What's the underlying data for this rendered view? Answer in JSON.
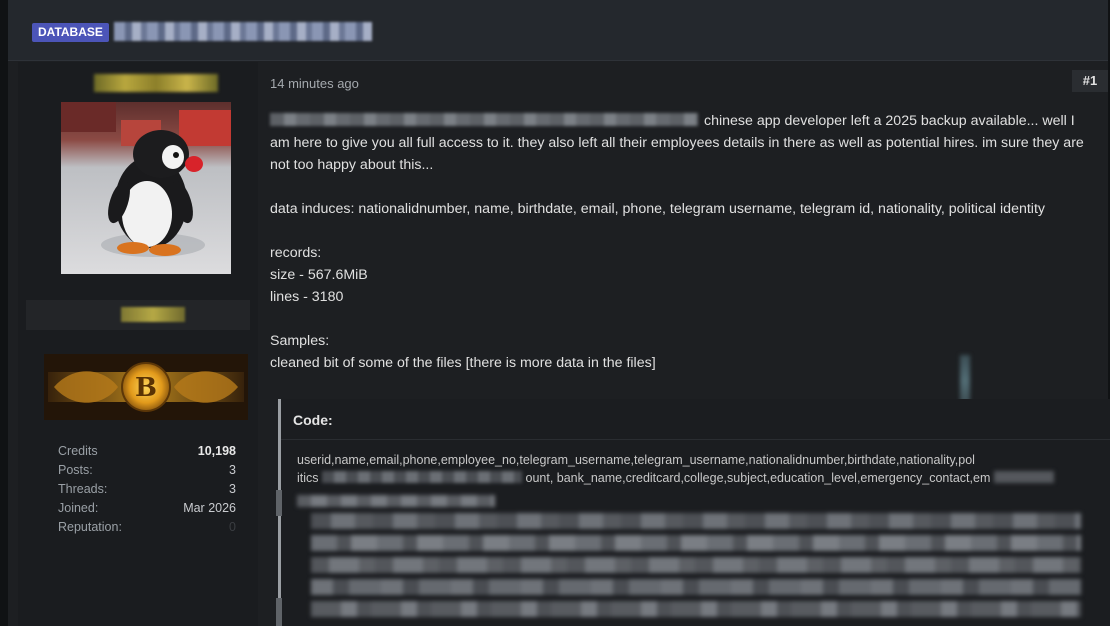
{
  "header": {
    "tag_label": "DATABASE"
  },
  "sidebar": {
    "stats": [
      {
        "label": "Credits",
        "value": "10,198"
      },
      {
        "label": "Posts:",
        "value": "3"
      },
      {
        "label": "Threads:",
        "value": "3"
      },
      {
        "label": "Joined:",
        "value": "Mar 2026"
      },
      {
        "label": "Reputation:",
        "value": "0"
      }
    ],
    "userbar_letter": "B"
  },
  "post": {
    "time": "14 minutes ago",
    "number": "#1",
    "paragraph1_line1_tail": "chinese app developer left a 2025 backup available...",
    "paragraph1_rest": "well I am here to give you all full access to it. they also left all their employees details in there as well as potential hires. im sure they are not too happy about this...",
    "paragraph2": "data induces: nationalidnumber, name, birthdate, email, phone, telegram username, telegram id, nationality, political identity",
    "records_heading": "records:",
    "records_size": "size - 567.6MiB",
    "records_lines": "lines - 3180",
    "samples_heading": "Samples:",
    "samples_text": "cleaned bit of some of the files [there is more data in the files]"
  },
  "code": {
    "title": "Code:",
    "line1": "userid,name,email,phone,employee_no,telegram_username,telegram_username,nationalidnumber,birthdate,nationality,pol",
    "line2_start": "itics",
    "line2_visible": "ount, bank_name,creditcard,college,subject,education_level,emergency_contact,em"
  },
  "colors": {
    "tag_bg": "#4c55b8",
    "page_bg": "#1d1f22",
    "header_bg": "#24282d"
  }
}
